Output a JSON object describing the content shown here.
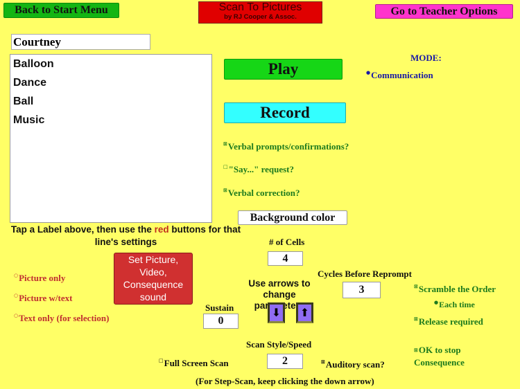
{
  "header": {
    "back_button": "Back to Start Menu",
    "app_title": "Scan To Pictures",
    "app_subtitle": "by RJ Cooper & Assoc.",
    "teacher_button": "Go to Teacher Options"
  },
  "user": {
    "name": "Courtney"
  },
  "labels_list": [
    "Balloon",
    "Dance",
    "Ball",
    "Music"
  ],
  "actions": {
    "play": "Play",
    "record": "Record",
    "background_color": "Background color"
  },
  "mode": {
    "label": "MODE:",
    "options": [
      {
        "label": "Communication",
        "selected": true
      }
    ]
  },
  "verbal_options": [
    {
      "label": "Verbal prompts/confirmations?",
      "checked": true
    },
    {
      "label": "\"Say...\" request?",
      "checked": false
    },
    {
      "label": "Verbal correction?",
      "checked": true
    }
  ],
  "instructions": {
    "part1": "Tap a Label above, then use the ",
    "red_word": "red",
    "part2": " buttons for that line's settings"
  },
  "set_button": "Set Picture, Video, Consequence sound",
  "display_options": [
    {
      "label": "Picture only",
      "selected": false
    },
    {
      "label": "Picture w/text",
      "selected": false
    },
    {
      "label": "Text only (for selection)",
      "selected": false
    }
  ],
  "parameters": {
    "cells_label": "# of Cells",
    "cells_value": "4",
    "cycles_label": "Cycles Before Reprompt",
    "cycles_value": "3",
    "sustain_label": "Sustain",
    "sustain_value": "0",
    "arrows_label": "Use arrows to change parameters",
    "down_icon": "down-arrow",
    "up_icon": "up-arrow",
    "scan_label": "Scan Style/Speed",
    "scan_value": "2",
    "step_scan_note": "(For Step-Scan, keep clicking the down arrow)"
  },
  "right_options": {
    "scramble": {
      "label": "Scramble the Order",
      "checked": true
    },
    "each_time": {
      "label": "Each time",
      "selected": true
    },
    "release": {
      "label": "Release required",
      "checked": true
    },
    "ok_stop": {
      "label": "OK to stop Consequence",
      "checked": true
    }
  },
  "scan_options": {
    "full_screen": {
      "label": "Full Screen Scan",
      "checked": false
    },
    "auditory": {
      "label": "Auditory scan?",
      "checked": true
    }
  }
}
